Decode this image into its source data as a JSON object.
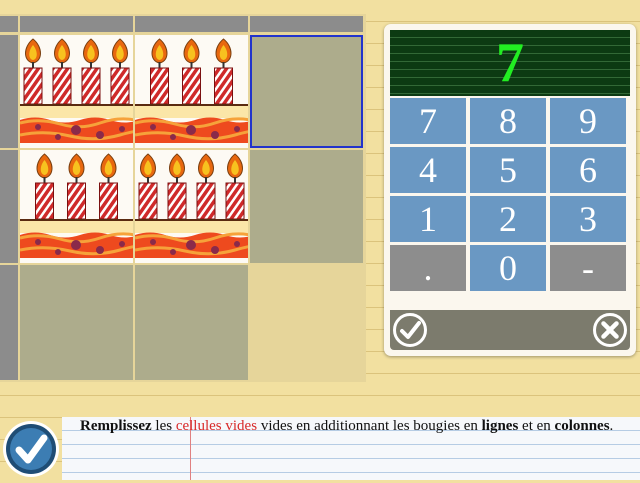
{
  "grid": {
    "rows": 3,
    "cols": 3,
    "cells": [
      {
        "row": 0,
        "col": 0,
        "type": "cake",
        "candles": 4
      },
      {
        "row": 0,
        "col": 1,
        "type": "cake",
        "candles": 3
      },
      {
        "row": 0,
        "col": 2,
        "type": "empty",
        "active": true
      },
      {
        "row": 1,
        "col": 0,
        "type": "cake",
        "candles": 3
      },
      {
        "row": 1,
        "col": 1,
        "type": "cake",
        "candles": 4
      },
      {
        "row": 1,
        "col": 2,
        "type": "empty"
      },
      {
        "row": 2,
        "col": 0,
        "type": "empty"
      },
      {
        "row": 2,
        "col": 1,
        "type": "empty"
      }
    ]
  },
  "keypad": {
    "display": "7",
    "keys": [
      "7",
      "8",
      "9",
      "4",
      "5",
      "6",
      "1",
      "2",
      "3",
      ".",
      "0",
      "-"
    ],
    "confirm_icon": "check-circle-icon",
    "cancel_icon": "close-circle-icon"
  },
  "instructions": {
    "part1": "Remplissez",
    "part2": " les ",
    "part3": "cellules vides",
    "part4": " vides en additionnant les bougies en ",
    "part5": "lignes",
    "part6": " et en ",
    "part7": "colonnes",
    "part8": "."
  },
  "main_button_icon": "check-icon",
  "colors": {
    "display_digit": "#22ee22",
    "key_blue": "#6a98c3",
    "key_grey": "#8d8d8d",
    "active_border": "#2233cc",
    "highlight_text": "#d82a2a"
  }
}
